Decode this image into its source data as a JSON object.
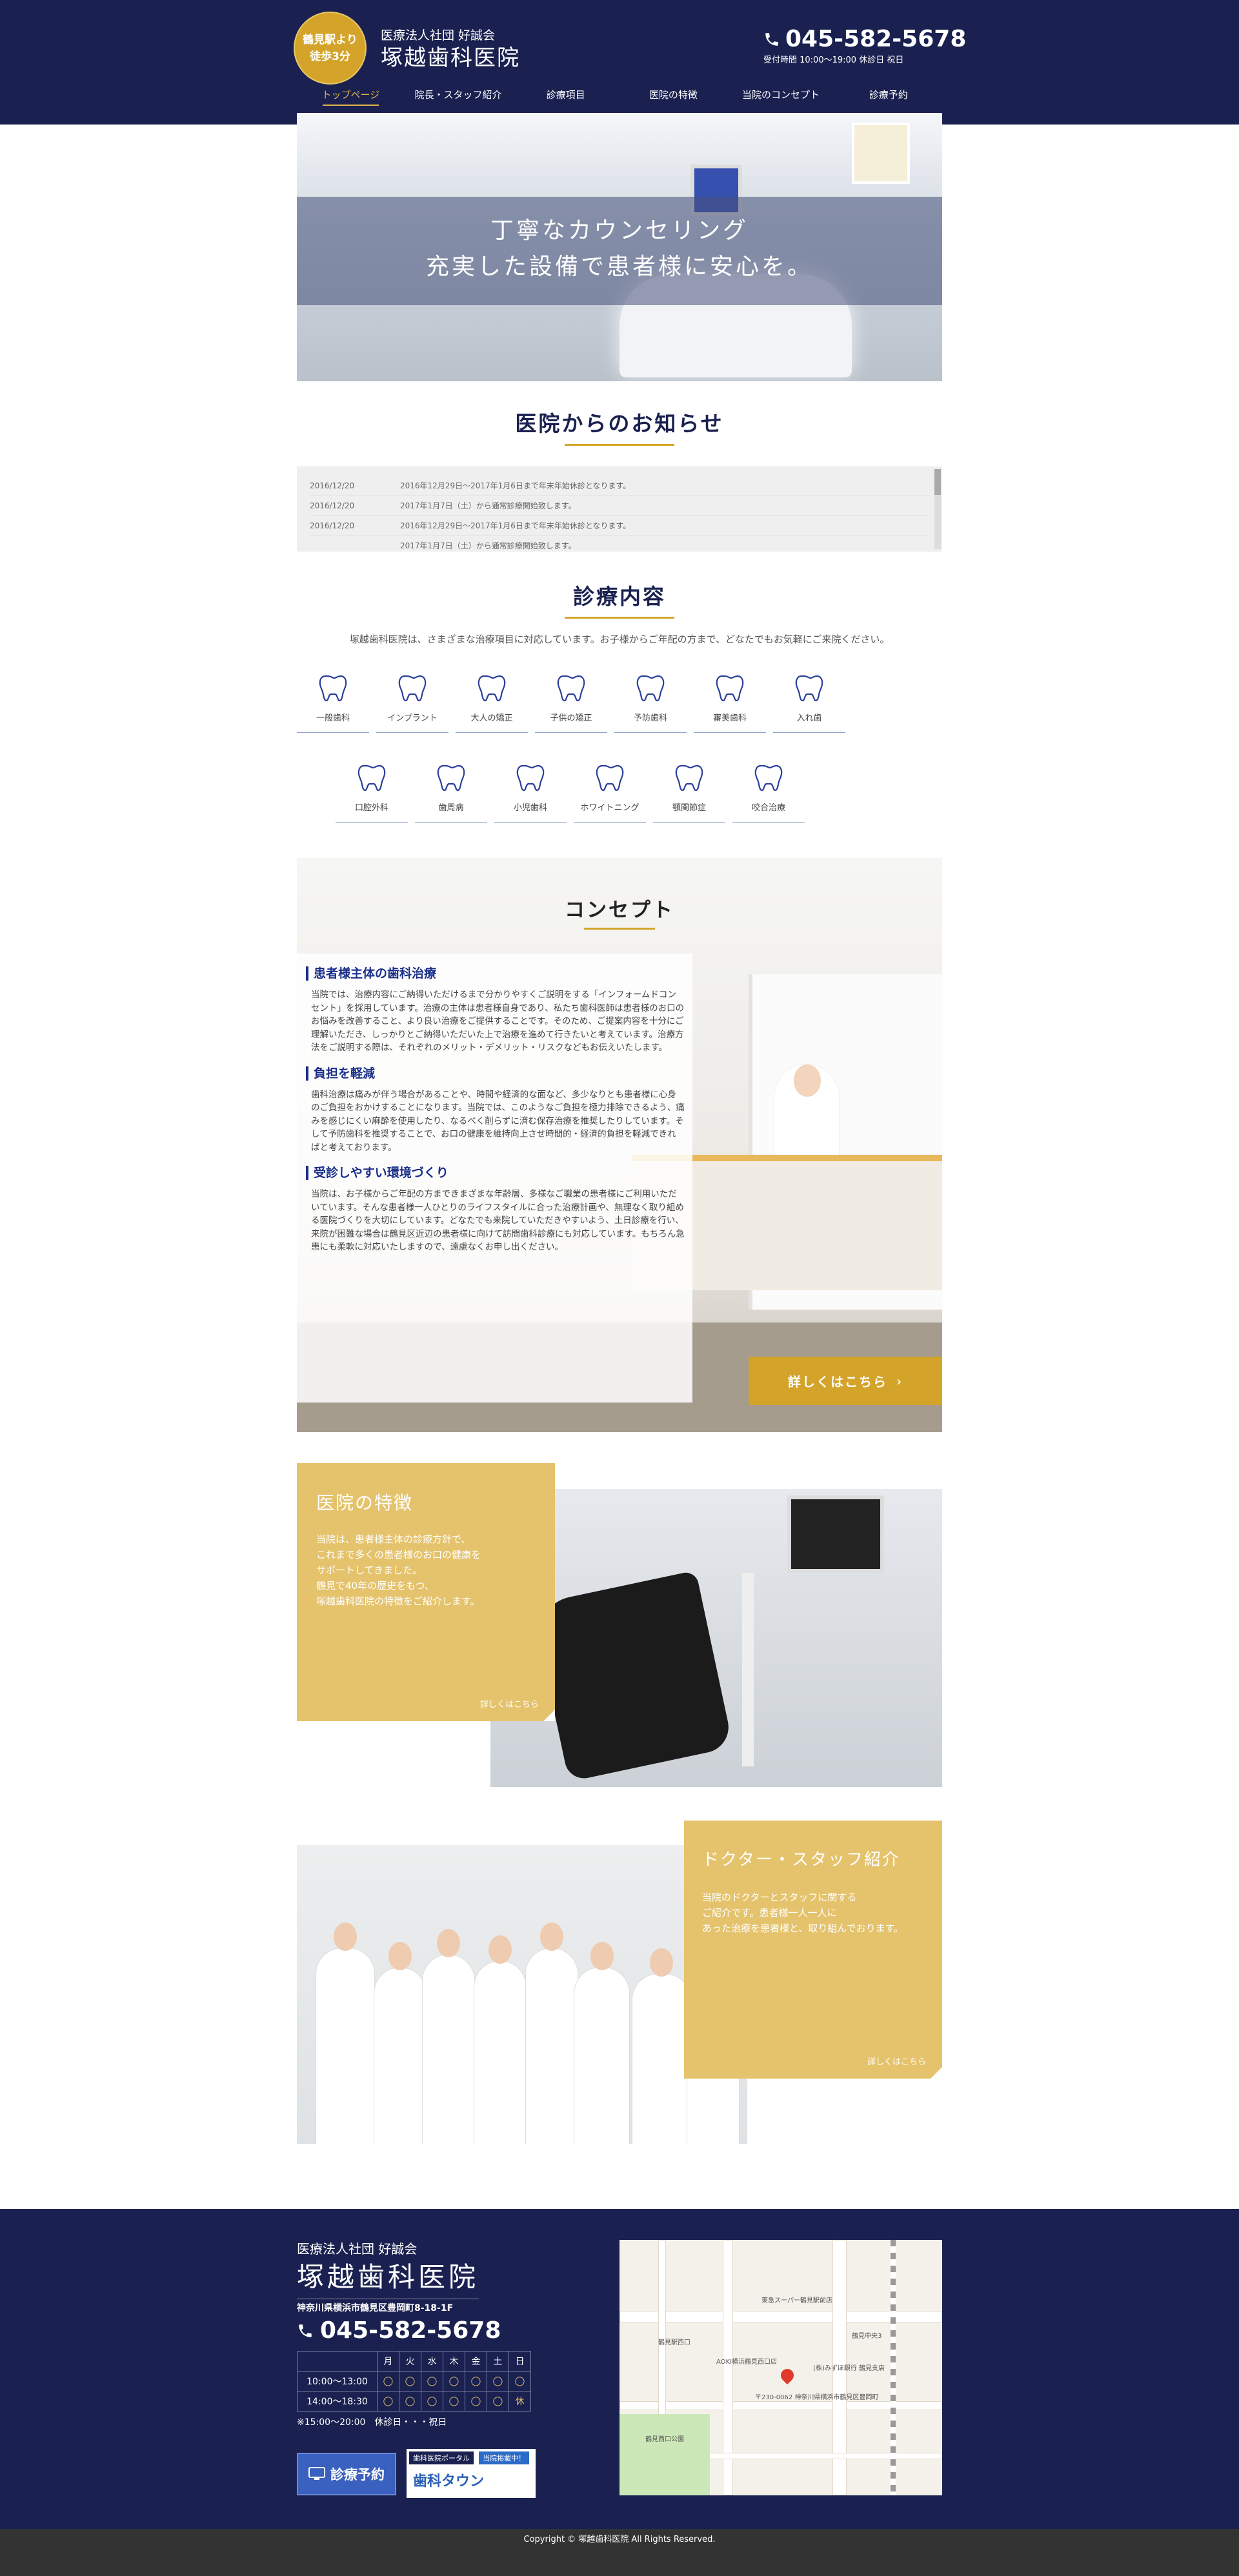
{
  "header": {
    "badge": [
      "鶴見駅より",
      "徒歩3分"
    ],
    "corp": "医療法人社団 好誠会",
    "name": "塚越歯科医院",
    "tel": "045-582-5678",
    "hours": "受付時間 10:00〜19:00 休診日 祝日",
    "nav": [
      "トップページ",
      "院長・スタッフ紹介",
      "診療項目",
      "医院の特徴",
      "当院のコンセプト",
      "診療予約"
    ]
  },
  "hero": {
    "line1": "丁寧なカウンセリング",
    "line2": "充実した設備で患者様に安心を。"
  },
  "news": {
    "title": "医院からのお知らせ",
    "items": [
      {
        "date": "2016/12/20",
        "text": "2016年12月29日〜2017年1月6日まで年末年始休診となります。"
      },
      {
        "date": "2016/12/20",
        "text": "2017年1月7日（土）から通常診療開始致します。"
      },
      {
        "date": "2016/12/20",
        "text": "2016年12月29日〜2017年1月6日まで年末年始休診となります。"
      },
      {
        "date": "",
        "text": "2017年1月7日（土）から通常診療開始致します。"
      }
    ]
  },
  "treatments": {
    "title": "診療内容",
    "intro": "塚越歯科医院は、さまざまな治療項目に対応しています。お子様からご年配の方まで、どなたでもお気軽にご来院ください。",
    "items": [
      "一般歯科",
      "インプラント",
      "大人の矯正",
      "子供の矯正",
      "予防歯科",
      "審美歯科",
      "入れ歯",
      "口腔外科",
      "歯周病",
      "小児歯科",
      "ホワイトニング",
      "顎関節症",
      "咬合治療"
    ]
  },
  "concept": {
    "title": "コンセプト",
    "sections": [
      {
        "heading": "患者様主体の歯科治療",
        "body": "当院では、治療内容にご納得いただけるまで分かりやすくご説明をする「インフォームドコンセント」を採用しています。治療の主体は患者様自身であり、私たち歯科医師は患者様のお口のお悩みを改善すること、より良い治療をご提供することです。そのため、ご提案内容を十分にご理解いただき、しっかりとご納得いただいた上で治療を進めて行きたいと考えています。治療方法をご説明する際は、それぞれのメリット・デメリット・リスクなどもお伝えいたします。"
      },
      {
        "heading": "負担を軽減",
        "body": "歯科治療は痛みが伴う場合があることや、時間や経済的な面など、多少なりとも患者様に心身のご負担をおかけすることになります。当院では、このようなご負担を極力排除できるよう、痛みを感じにくい麻酔を使用したり、なるべく削らずに済む保存治療を推奨したりしています。そして予防歯科を推奨することで、お口の健康を維持向上させ時間的・経済的負担を軽減できればと考えております。"
      },
      {
        "heading": "受診しやすい環境づくり",
        "body": "当院は、お子様からご年配の方まできまざまな年齢層、多様なご職業の患者様にご利用いただいています。そんな患者様一人ひとりのライフスタイルに合った治療計画や、無理なく取り組める医院づくりを大切にしています。どなたでも来院していただきやすいよう、土日診療を行い、来院が困難な場合は鶴見区近辺の患者様に向けて訪問歯科診療にも対応しています。もちろん急患にも柔軟に対応いたしますので、遠慮なくお申し出ください。"
      }
    ],
    "button": "詳しくはこちら"
  },
  "features": {
    "title": "医院の特徴",
    "body": [
      "当院は、患者様主体の診療方針で、",
      "これまで多くの患者様のお口の健康を",
      "サポートしてきました。",
      "鶴見で40年の歴史をもつ、",
      "塚越歯科医院の特徴をご紹介します。"
    ],
    "more": "詳しくはこちら"
  },
  "staff": {
    "title": "ドクター・スタッフ紹介",
    "body": [
      "当院のドクターとスタッフに関する",
      "ご紹介です。患者様一人一人に",
      "あった治療を患者様と、取り組んでおります。"
    ],
    "more": "詳しくはこちら"
  },
  "footer": {
    "corp": "医療法人社団 好誠会",
    "name": "塚越歯科医院",
    "address": "神奈川県横浜市鶴見区豊岡町8-18-1F",
    "tel": "045-582-5678",
    "table": {
      "days": [
        "月",
        "火",
        "水",
        "木",
        "金",
        "土",
        "日"
      ],
      "rows": [
        {
          "time": "10:00〜13:00",
          "marks": [
            "◯",
            "◯",
            "◯",
            "◯",
            "◯",
            "◯",
            "◯"
          ]
        },
        {
          "time": "14:00〜18:30",
          "marks": [
            "◯",
            "◯",
            "◯",
            "◯",
            "◯",
            "◯",
            "休"
          ]
        }
      ]
    },
    "note": "※15:00〜20:00　休診日・・・祝日",
    "reserve": "診療予約",
    "banner_top": "歯科医院ポータル",
    "banner_tag": "当院掲載中！",
    "banner_name": "歯科タウン",
    "map": {
      "labels": [
        "鶴見駅西口",
        "東急スーパー鶴見駅前店",
        "AOKI横浜鶴見西口店",
        "(株)みずほ銀行 鶴見支店",
        "〒230-0062 神奈川県横浜市鶴見区豊岡町",
        "鶴見西口公園",
        "鶴見中央3"
      ]
    }
  },
  "copyright": "Copyright © 塚越歯科医院 All Rights Reserved."
}
